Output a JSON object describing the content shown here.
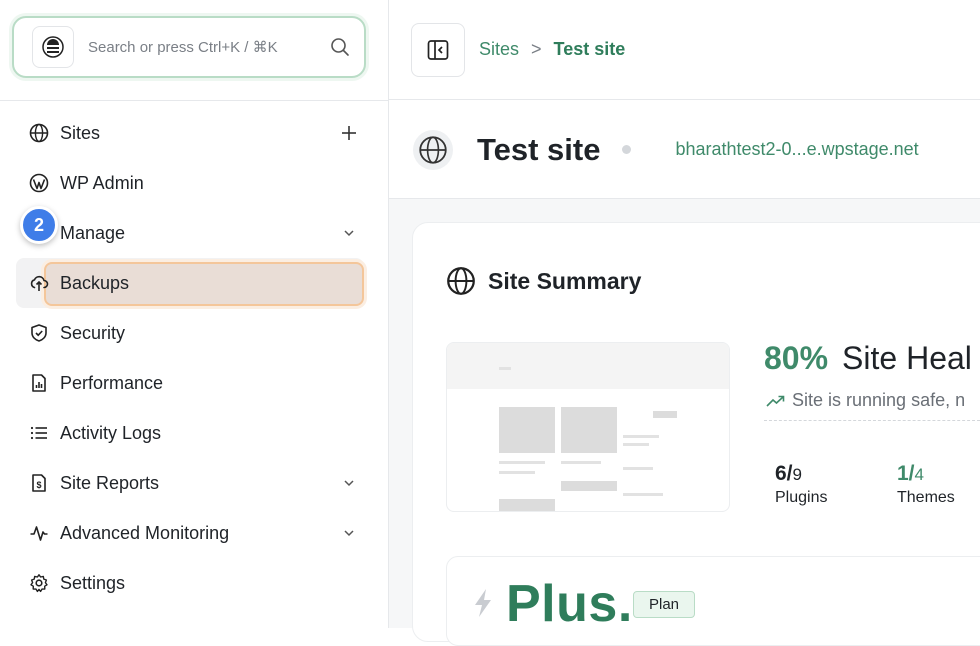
{
  "search": {
    "placeholder": "Search or press Ctrl+K / ⌘K"
  },
  "sidebar": {
    "step_badge": "2",
    "items": [
      {
        "label": "Sites",
        "icon": "globe-icon",
        "trail": "plus"
      },
      {
        "label": "WP Admin",
        "icon": "wordpress-icon",
        "trail": ""
      },
      {
        "label": "Manage",
        "icon": "manage-icon",
        "trail": "chevron"
      },
      {
        "label": "Backups",
        "icon": "cloud-upload-icon",
        "trail": "",
        "active": true
      },
      {
        "label": "Security",
        "icon": "shield-icon",
        "trail": ""
      },
      {
        "label": "Performance",
        "icon": "performance-report-icon",
        "trail": ""
      },
      {
        "label": "Activity Logs",
        "icon": "list-icon",
        "trail": ""
      },
      {
        "label": "Site Reports",
        "icon": "report-icon",
        "trail": "chevron"
      },
      {
        "label": "Advanced Monitoring",
        "icon": "pulse-icon",
        "trail": "chevron"
      },
      {
        "label": "Settings",
        "icon": "gear-icon",
        "trail": ""
      }
    ]
  },
  "breadcrumb": {
    "root": "Sites",
    "separator": ">",
    "current": "Test site"
  },
  "site": {
    "title": "Test site",
    "url": "bharathtest2-0...e.wpstage.net"
  },
  "summary": {
    "title": "Site Summary",
    "health_percent": "80%",
    "health_label": "Site Heal",
    "health_status": "Site is running safe, n",
    "stats": [
      {
        "value": "6/",
        "total": "9",
        "label": "Plugins"
      },
      {
        "value": "1/",
        "total": "4",
        "label": "Themes"
      }
    ]
  },
  "plan": {
    "name": "Plus.",
    "badge": "Plan"
  },
  "colors": {
    "accent": "#3f8a6a",
    "badge": "#3f7de8",
    "highlight": "#f4c69a"
  }
}
